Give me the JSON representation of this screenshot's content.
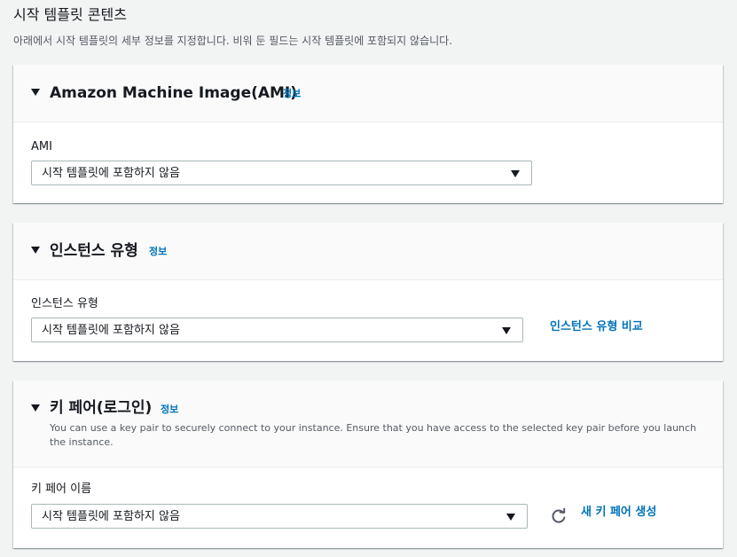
{
  "page": {
    "title": "시작 템플릿 콘텐츠",
    "description": "아래에서 시작 템플릿의 세부 정보를 지정합니다. 비워 둔 필드는 시작 템플릿에 포함되지 않습니다."
  },
  "ami_panel": {
    "title": "Amazon Machine Image(AMI)",
    "info_label": "정보",
    "field_label": "AMI",
    "select_value": "시작 템플릿에 포함하지 않음"
  },
  "instance_panel": {
    "title": "인스턴스 유형",
    "info_label": "정보",
    "field_label": "인스턴스 유형",
    "select_value": "시작 템플릿에 포함하지 않음",
    "compare_link": "인스턴스 유형 비교"
  },
  "keypair_panel": {
    "title": "키 페어(로그인)",
    "info_label": "정보",
    "description": "You can use a key pair to securely connect to your instance. Ensure that you have access to the selected key pair before you launch the instance.",
    "field_label": "키 페어 이름",
    "select_value": "시작 템플릿에 포함하지 않음",
    "refresh_icon": "refresh-icon",
    "create_link": "새 키 페어 생성"
  },
  "colors": {
    "link": "#0073bb",
    "background": "#f2f3f3",
    "text": "#16191f",
    "secondary_text": "#545b64"
  }
}
